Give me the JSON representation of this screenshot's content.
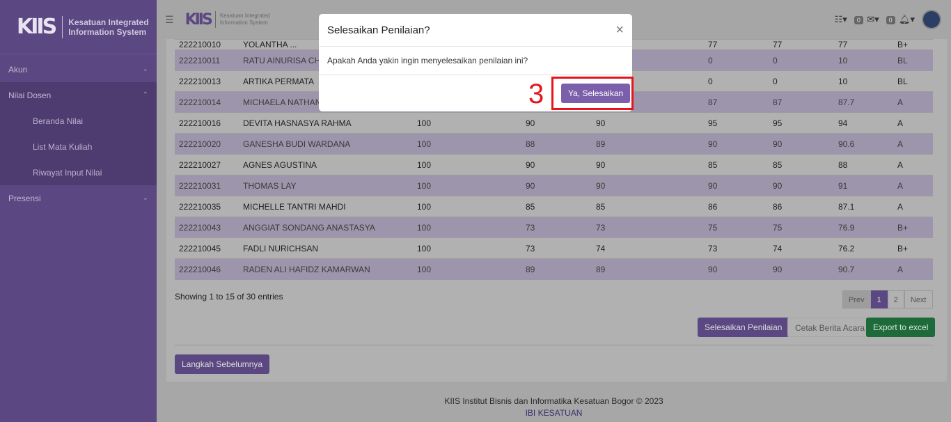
{
  "sidebar": {
    "brand_logo": "KIIS",
    "brand_line1": "Kesatuan Integrated",
    "brand_line2": "Information System",
    "items": [
      {
        "label": "Akun",
        "chev": "⌄"
      },
      {
        "label": "Nilai Dosen",
        "chev": "⌃"
      },
      {
        "label": "Presensi",
        "chev": "⌄"
      }
    ],
    "subitems": [
      "Beranda Nilai",
      "List Mata Kuliah",
      "Riwayat Input Nilai"
    ]
  },
  "topbar": {
    "menu_icon": "☰",
    "logo": "KIIS",
    "line1": "Kesatuan Integrated",
    "line2": "Information System",
    "list_icon": "☷▾",
    "mail_count": "0",
    "mail_icon": "✉▾",
    "notif_count": "0",
    "bell_icon": "🔔︎▾"
  },
  "table": {
    "top_partial": [
      "222210010",
      "YOLANTHA ...",
      "",
      "",
      "",
      "77",
      "77",
      "77",
      "B+"
    ],
    "rows": [
      [
        "222210011",
        "RATU AINURISA CHA",
        "",
        "",
        "",
        "0",
        "0",
        "10",
        "BL"
      ],
      [
        "222210013",
        "ARTIKA PERMATA",
        "",
        "",
        "",
        "0",
        "0",
        "10",
        "BL"
      ],
      [
        "222210014",
        "MICHAELA NATHANI",
        "",
        "",
        "",
        "87",
        "87",
        "87.7",
        "A"
      ],
      [
        "222210016",
        "DEVITA HASNASYA RAHMA",
        "100",
        "90",
        "90",
        "95",
        "95",
        "94",
        "A"
      ],
      [
        "222210020",
        "GANESHA BUDI WARDANA",
        "100",
        "88",
        "89",
        "90",
        "90",
        "90.6",
        "A"
      ],
      [
        "222210027",
        "AGNES AGUSTINA",
        "100",
        "90",
        "90",
        "85",
        "85",
        "88",
        "A"
      ],
      [
        "222210031",
        "THOMAS LAY",
        "100",
        "90",
        "90",
        "90",
        "90",
        "91",
        "A"
      ],
      [
        "222210035",
        "MICHELLE TANTRI MAHDI",
        "100",
        "85",
        "85",
        "86",
        "86",
        "87.1",
        "A"
      ],
      [
        "222210043",
        "ANGGIAT SONDANG ANASTASYA",
        "100",
        "73",
        "73",
        "75",
        "75",
        "76.9",
        "B+"
      ],
      [
        "222210045",
        "FADLI NURICHSAN",
        "100",
        "73",
        "74",
        "73",
        "74",
        "76.2",
        "B+"
      ],
      [
        "222210046",
        "RADEN ALI HAFIDZ KAMARWAN",
        "100",
        "89",
        "89",
        "90",
        "90",
        "90.7",
        "A"
      ]
    ]
  },
  "showing": "Showing 1 to 15 of 30 entries",
  "pager": {
    "prev": "Prev",
    "p1": "1",
    "p2": "2",
    "next": "Next"
  },
  "actions": {
    "finish": "Selesaikan Penilaian",
    "print": "Cetak Berita Acara",
    "excel": "Export to excel",
    "back": "Langkah Sebelumnya"
  },
  "footer": {
    "line1": "KIIS Institut Bisnis dan Informatika Kesatuan Bogor © 2023",
    "line2": "IBI KESATUAN"
  },
  "modal": {
    "title": "Selesaikan Penilaian?",
    "close": "×",
    "body": "Apakah Anda yakin ingin menyelesaikan penilaian ini?",
    "confirm": "Ya, Selesaikan",
    "step": "3"
  }
}
